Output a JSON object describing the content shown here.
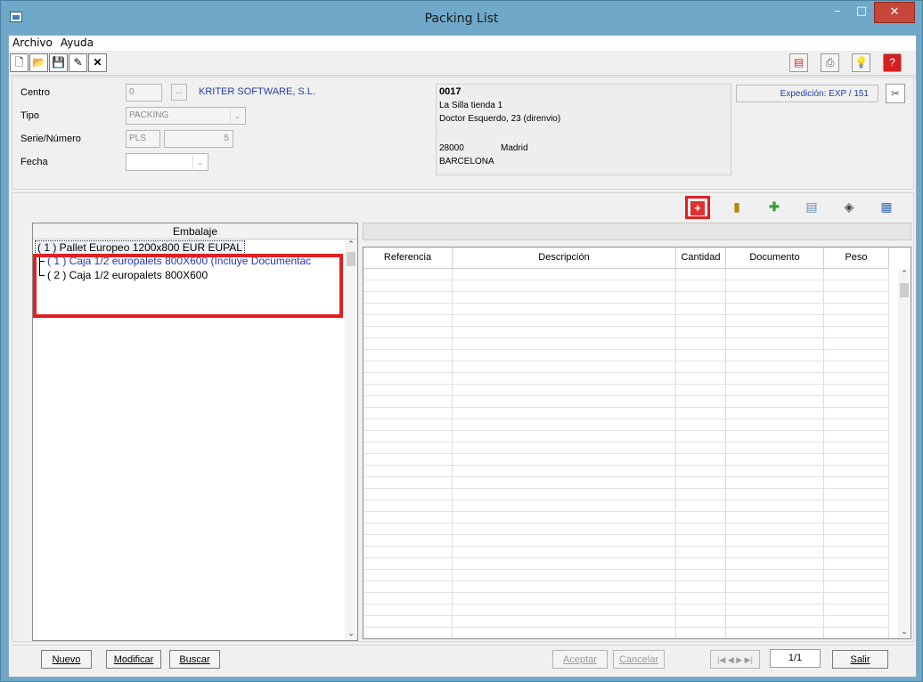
{
  "window": {
    "title": "Packing List"
  },
  "menu": {
    "archivo": "Archivo",
    "ayuda": "Ayuda"
  },
  "toolbar": {
    "left_icons": [
      "new-document-icon",
      "open-folder-icon",
      "save-icon",
      "edit-icon",
      "close-x-icon"
    ],
    "right_icons": [
      "export-icon",
      "print-icon",
      "bulb-icon",
      "help-icon"
    ]
  },
  "header": {
    "centro_label": "Centro",
    "centro_value": "0",
    "centro_btn": "...",
    "company": "KRITER SOFTWARE, S.L.",
    "tipo_label": "Tipo",
    "tipo_value": "PACKING",
    "serie_label": "Serie/Número",
    "serie_value": "PLS",
    "numero_value": "5",
    "fecha_label": "Fecha",
    "fecha_value": "",
    "address": {
      "code": "0017",
      "line1": "La Silla tienda 1",
      "line2": "Doctor Esquerdo, 23 (direnvio)",
      "postal": "28000",
      "city": "Madrid",
      "region": "BARCELONA"
    },
    "expedicion": "Expedición: EXP / 151"
  },
  "tree": {
    "header": "Embalaje",
    "root": "( 1 ) Pallet Europeo 1200x800 EUR EUPAL",
    "child1": "( 1 ) Caja 1/2 europalets 800X600 (Incluye Documentac",
    "child2": "( 2 ) Caja 1/2 europalets 800X600"
  },
  "grid": {
    "columns": [
      "Referencia",
      "Descripción",
      "Cantidad",
      "Documento",
      "Peso"
    ]
  },
  "footer": {
    "nuevo": "Nuevo",
    "modificar": "Modificar",
    "buscar": "Buscar",
    "aceptar": "Aceptar",
    "cancelar": "Cancelar",
    "nav": "|◀ ◀ ▶ ▶|",
    "page": "1/1",
    "salir": "Salir"
  },
  "colors": {
    "accent_blue": "#1f3fa8",
    "highlight_red": "#e02020",
    "titlebar": "#6fa8c9"
  }
}
